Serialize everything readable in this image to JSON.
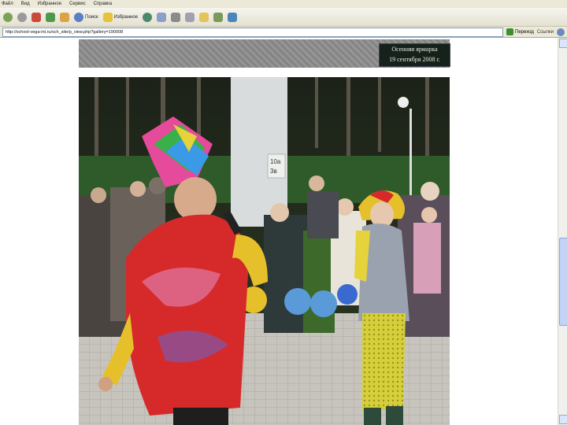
{
  "menubar": {
    "items": [
      "Файл",
      "Вид",
      "Избранное",
      "Сервис",
      "Справка"
    ]
  },
  "toolbar": {
    "search_label": "Поиск",
    "favorites_label": "Избранное"
  },
  "address": {
    "url": "http://school-vega-int.ru/sch_site/p_view.php?gallery=190008",
    "go_label": "Переход",
    "links_label": "Ссылки"
  },
  "caption": {
    "line1": "Осенняя ярмарка",
    "line2": "19 сентября 2008 г."
  },
  "photo": {
    "sign_line1": "10а",
    "sign_line2": "3в"
  },
  "colors": {
    "chrome": "#ece9d8",
    "caption_bg": "#16211c",
    "scroll_thumb": "#c3d3f5"
  }
}
